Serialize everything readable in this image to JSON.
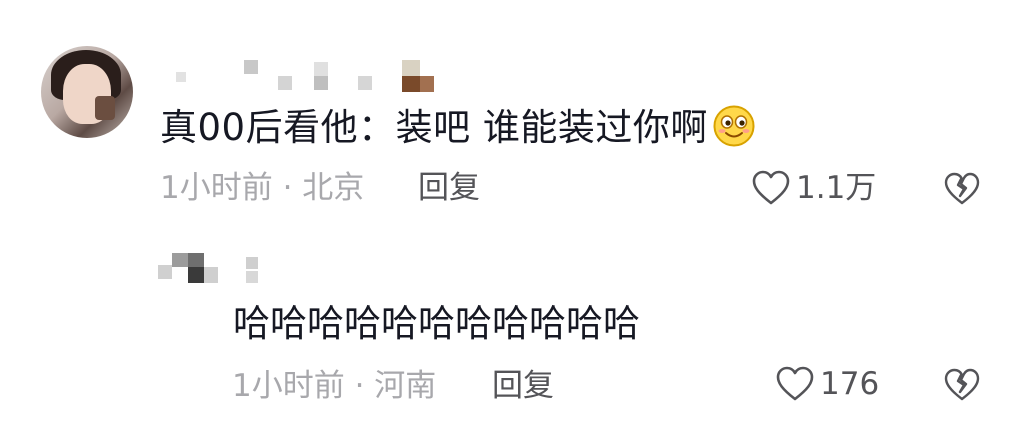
{
  "comment": {
    "text": "真00后看他：装吧 谁能装过你啊",
    "time": "1小时前",
    "location": "北京",
    "reply_label": "回复",
    "likes": "1.1万"
  },
  "reply": {
    "text": "哈哈哈哈哈哈哈哈哈哈哈",
    "time": "1小时前",
    "location": "河南",
    "reply_label": "回复",
    "likes": "176"
  },
  "icons": {
    "like": "heart-outline-icon",
    "dislike": "broken-heart-icon",
    "emoji": "smiling-face-emoji"
  },
  "colors": {
    "text": "#161823",
    "meta": "#a8a8ac",
    "action": "#545458",
    "emoji_yellow": "#ffd84a"
  }
}
